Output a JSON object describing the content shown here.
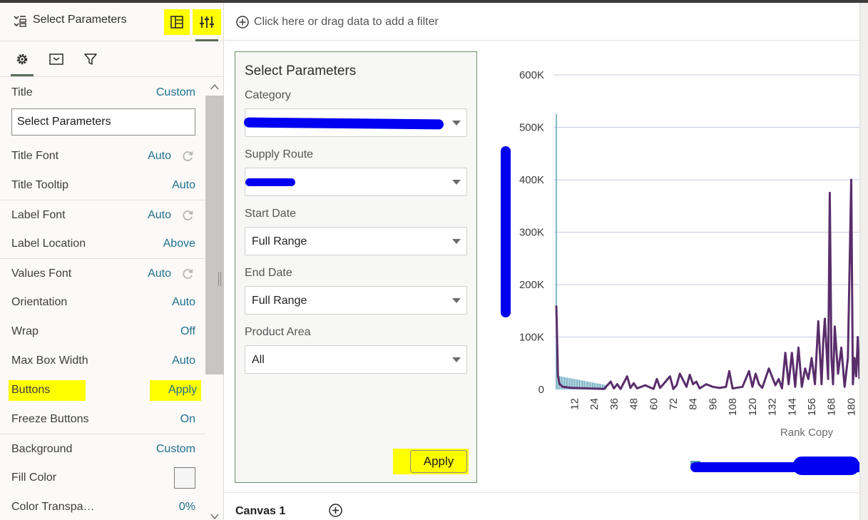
{
  "panel": {
    "title": "Select Parameters",
    "tabs": [
      "general-settings",
      "values",
      "filters"
    ],
    "rows": {
      "title_label": "Title",
      "title_value": "Custom",
      "title_input": "Select Parameters",
      "title_font_label": "Title Font",
      "title_font_value": "Auto",
      "title_tooltip_label": "Title Tooltip",
      "title_tooltip_value": "Auto",
      "label_font_label": "Label Font",
      "label_font_value": "Auto",
      "label_location_label": "Label Location",
      "label_location_value": "Above",
      "values_font_label": "Values Font",
      "values_font_value": "Auto",
      "orientation_label": "Orientation",
      "orientation_value": "Auto",
      "wrap_label": "Wrap",
      "wrap_value": "Off",
      "max_box_width_label": "Max Box Width",
      "max_box_width_value": "Auto",
      "buttons_label": "Buttons",
      "buttons_value": "Apply",
      "freeze_buttons_label": "Freeze Buttons",
      "freeze_buttons_value": "On",
      "background_label": "Background",
      "background_value": "Custom",
      "fill_color_label": "Fill Color",
      "color_transparency_label": "Color Transpa…",
      "color_transparency_value": "0%"
    }
  },
  "filterbar": {
    "text": "Click here or drag data to add a filter"
  },
  "card": {
    "title": "Select Parameters",
    "fields": [
      {
        "label": "Category",
        "value": ""
      },
      {
        "label": "Supply Route",
        "value": ""
      },
      {
        "label": "Start Date",
        "value": "Full Range"
      },
      {
        "label": "End Date",
        "value": "Full Range"
      },
      {
        "label": "Product Area",
        "value": "All"
      }
    ],
    "apply_label": "Apply"
  },
  "canvas": {
    "tab_label": "Canvas 1"
  },
  "colors": {
    "accent_link": "#1f6e8c",
    "highlight": "#ffff00",
    "redaction": "#0000f0",
    "line_series": "#5a2d6b",
    "bar_series": "#5aa0b5",
    "gridline": "#c8cde0"
  },
  "chart_data": {
    "type": "line",
    "xlabel": "Rank Copy",
    "ylabel": "",
    "ylim": [
      0,
      600000
    ],
    "yticks": [
      "0",
      "100K",
      "200K",
      "300K",
      "400K",
      "500K",
      "600K"
    ],
    "xticks": [
      "12",
      "24",
      "36",
      "48",
      "60",
      "72",
      "84",
      "96",
      "108",
      "120",
      "132",
      "144",
      "156",
      "168",
      "180"
    ],
    "xlim": [
      1,
      185
    ],
    "grid": true,
    "legend": "bottom",
    "series": [
      {
        "x": [
          1,
          2,
          3,
          5,
          10,
          20,
          30,
          34,
          36,
          38,
          40,
          44,
          46,
          48,
          50,
          55,
          60,
          62,
          64,
          66,
          70,
          72,
          74,
          76,
          80,
          82,
          84,
          86,
          88,
          92,
          96,
          100,
          104,
          106,
          108,
          110,
          114,
          118,
          120,
          122,
          124,
          126,
          130,
          134,
          136,
          138,
          140,
          142,
          144,
          146,
          148,
          150,
          152,
          154,
          156,
          158,
          160,
          162,
          163,
          164,
          166,
          167,
          168,
          169,
          170,
          172,
          174,
          176,
          178,
          180,
          181,
          182,
          183,
          184,
          185
        ],
        "y": [
          160000,
          25000,
          10000,
          5000,
          3000,
          2000,
          1000,
          15000,
          2000,
          10000,
          1000,
          25000,
          3000,
          12000,
          2000,
          8000,
          1000,
          20000,
          3000,
          10000,
          25000,
          1000,
          8000,
          30000,
          5000,
          28000,
          10000,
          15000,
          2000,
          10000,
          5000,
          3000,
          5000,
          35000,
          2000,
          3000,
          5000,
          35000,
          5000,
          30000,
          10000,
          3000,
          40000,
          8000,
          20000,
          2000,
          70000,
          10000,
          70000,
          5000,
          80000,
          5000,
          40000,
          20000,
          60000,
          10000,
          130000,
          10000,
          90000,
          135000,
          20000,
          375000,
          60000,
          10000,
          120000,
          30000,
          80000,
          5000,
          60000,
          400000,
          10000,
          60000,
          25000,
          100000,
          20000
        ]
      }
    ]
  }
}
